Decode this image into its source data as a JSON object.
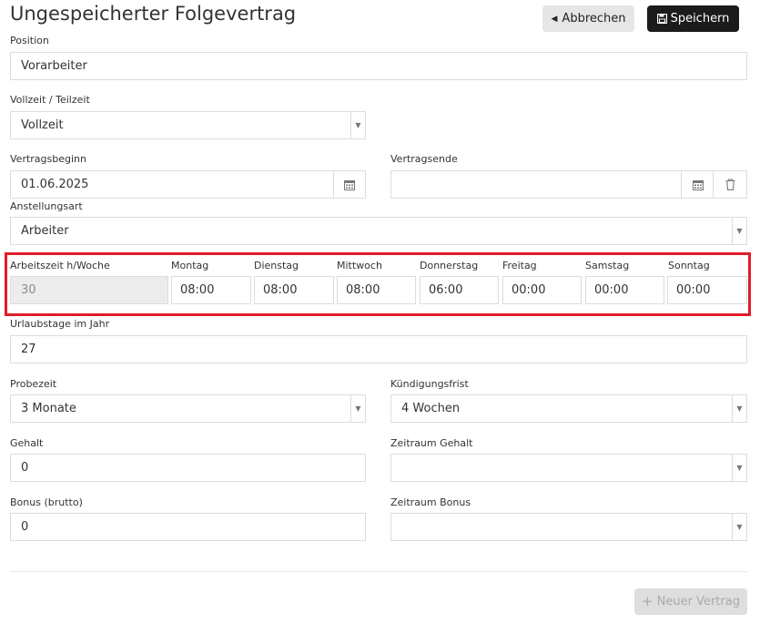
{
  "page": {
    "title": "Ungespeicherter Folgevertrag"
  },
  "toolbar": {
    "cancel_label": "Abbrechen",
    "save_label": "Speichern"
  },
  "form": {
    "position": {
      "label": "Position",
      "value": "Vorarbeiter"
    },
    "vollzeit": {
      "label": "Vollzeit / Teilzeit",
      "value": "Vollzeit"
    },
    "vertragsbeginn": {
      "label": "Vertragsbeginn",
      "value": "01.06.2025"
    },
    "vertragsende": {
      "label": "Vertragsende",
      "value": ""
    },
    "anstellungsart": {
      "label": "Anstellungsart",
      "value": "Arbeiter"
    },
    "arbeitszeit": {
      "label": "Arbeitszeit h/Woche",
      "value": "30"
    },
    "days": [
      {
        "label": "Montag",
        "value": "08:00"
      },
      {
        "label": "Dienstag",
        "value": "08:00"
      },
      {
        "label": "Mittwoch",
        "value": "08:00"
      },
      {
        "label": "Donnerstag",
        "value": "06:00"
      },
      {
        "label": "Freitag",
        "value": "00:00"
      },
      {
        "label": "Samstag",
        "value": "00:00"
      },
      {
        "label": "Sonntag",
        "value": "00:00"
      }
    ],
    "urlaub": {
      "label": "Urlaubstage im Jahr",
      "value": "27"
    },
    "probezeit": {
      "label": "Probezeit",
      "value": "3 Monate"
    },
    "kuendigung": {
      "label": "Kündigungsfrist",
      "value": "4 Wochen"
    },
    "gehalt": {
      "label": "Gehalt",
      "value": "0"
    },
    "zeitraum_gehalt": {
      "label": "Zeitraum Gehalt",
      "value": ""
    },
    "bonus": {
      "label": "Bonus (brutto)",
      "value": "0"
    },
    "zeitraum_bonus": {
      "label": "Zeitraum Bonus",
      "value": ""
    }
  },
  "footer": {
    "new_contract_label": "Neuer Vertrag"
  },
  "icons": {
    "cancel": "chevron-left-icon",
    "save": "floppy-disk-icon",
    "calendar": "calendar-icon",
    "delete": "trash-icon",
    "add": "plus-icon"
  },
  "colors": {
    "highlight": "#e01c2a",
    "primary_button": "#1b1b1b",
    "disabled_button": "#dedede"
  }
}
